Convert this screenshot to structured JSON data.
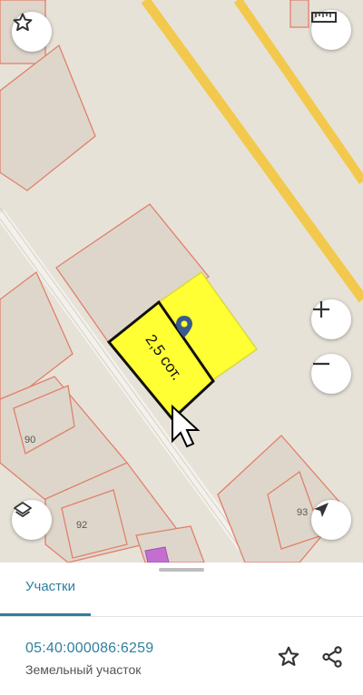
{
  "map": {
    "plot_area_label": "2,5 сот.",
    "house_numbers": [
      "90",
      "92",
      "93"
    ],
    "colors": {
      "background": "#e7e2d8",
      "road": "#f2c94c",
      "parcel_border": "#e0806a",
      "selected_fill": "#ffff33",
      "selected_border": "#111111"
    }
  },
  "controls": {
    "favorite_icon": "star-outline-icon",
    "ruler_icon": "ruler-icon",
    "zoom_in_icon": "plus-icon",
    "zoom_out_icon": "minus-icon",
    "layers_icon": "layers-icon",
    "location_icon": "navigation-arrow-icon"
  },
  "sheet": {
    "tab_label": "Участки",
    "cadastral_number": "05:40:000086:6259",
    "object_type": "Земельный участок",
    "accent_color": "#2f7f9e"
  }
}
